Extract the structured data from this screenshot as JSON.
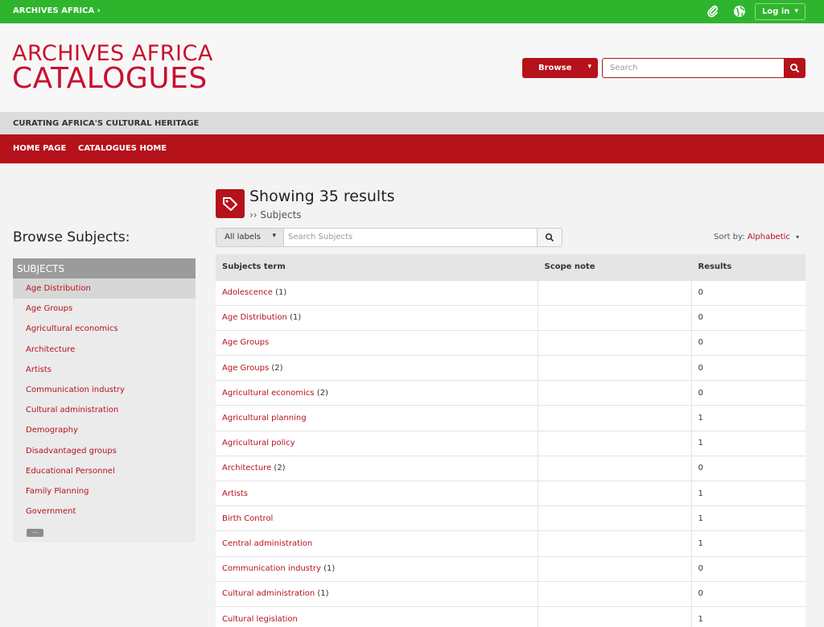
{
  "topbar": {
    "brand": "ARCHIVES AFRICA ›",
    "login": "Log in",
    "login_caret": "▾"
  },
  "header": {
    "logo_line1": "ARCHIVES AFRICA",
    "logo_line2": "CATALOGUES",
    "browse": "Browse",
    "browse_caret": "▾",
    "search_placeholder": "Search",
    "tagline": "CURATING AFRICA'S CULTURAL HERITAGE"
  },
  "nav": {
    "items": [
      "HOME PAGE",
      "CATALOGUES HOME"
    ]
  },
  "sidebar": {
    "title": "Browse Subjects:",
    "facet_title": "SUBJECTS",
    "items": [
      "Age Distribution",
      "Age Groups",
      "Agricultural economics",
      "Architecture",
      "Artists",
      "Communication industry",
      "Cultural administration",
      "Demography",
      "Disadvantaged groups",
      "Educational Personnel",
      "Family Planning",
      "Government"
    ],
    "more": "..."
  },
  "main": {
    "title": "Showing 35 results",
    "subtitle": "›› Subjects",
    "labels_dropdown": "All labels",
    "labels_caret": "▾",
    "search_placeholder": "Search Subjects",
    "sort_label": "Sort by:",
    "sort_value": "Alphabetic",
    "sort_caret": "▾",
    "columns": [
      "Subjects term",
      "Scope note",
      "Results"
    ],
    "rows": [
      {
        "term": "Adolescence",
        "count": "(1)",
        "scope": "",
        "results": "0"
      },
      {
        "term": "Age Distribution",
        "count": "(1)",
        "scope": "",
        "results": "0"
      },
      {
        "term": "Age Groups",
        "count": "",
        "scope": "",
        "results": "0"
      },
      {
        "term": "Age Groups",
        "count": "(2)",
        "scope": "",
        "results": "0"
      },
      {
        "term": "Agricultural economics",
        "count": "(2)",
        "scope": "",
        "results": "0"
      },
      {
        "term": "Agricultural planning",
        "count": "",
        "scope": "",
        "results": "1"
      },
      {
        "term": "Agricultural policy",
        "count": "",
        "scope": "",
        "results": "1"
      },
      {
        "term": "Architecture",
        "count": "(2)",
        "scope": "",
        "results": "0"
      },
      {
        "term": "Artists",
        "count": "",
        "scope": "",
        "results": "1"
      },
      {
        "term": "Birth Control",
        "count": "",
        "scope": "",
        "results": "1"
      },
      {
        "term": "Central administration",
        "count": "",
        "scope": "",
        "results": "1"
      },
      {
        "term": "Communication industry",
        "count": "(1)",
        "scope": "",
        "results": "0"
      },
      {
        "term": "Cultural administration",
        "count": "(1)",
        "scope": "",
        "results": "0"
      },
      {
        "term": "Cultural legislation",
        "count": "",
        "scope": "",
        "results": "1"
      }
    ]
  },
  "colors": {
    "brand_red": "#b5121b",
    "topbar_green": "#2fb52d"
  },
  "icons": {
    "clip": "paperclip-icon",
    "globe": "globe-icon",
    "search": "search-icon",
    "tag": "tag-icon"
  }
}
